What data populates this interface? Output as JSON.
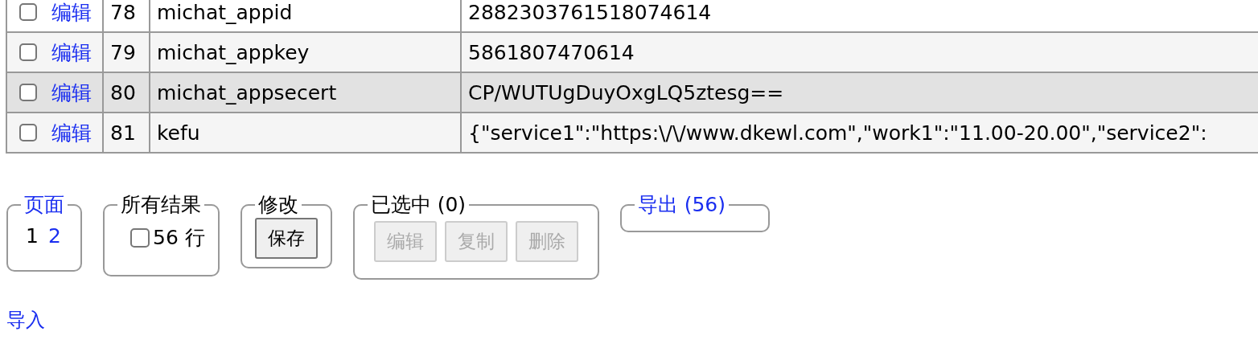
{
  "table": {
    "rows": [
      {
        "checked": false,
        "edit": "编辑",
        "id": "78",
        "name": "michat_appid",
        "value": "2882303761518074614",
        "hovered": false
      },
      {
        "checked": false,
        "edit": "编辑",
        "id": "79",
        "name": "michat_appkey",
        "value": "5861807470614",
        "hovered": false
      },
      {
        "checked": false,
        "edit": "编辑",
        "id": "80",
        "name": "michat_appsecert",
        "value": "CP/WUTUgDuyOxgLQ5ztesg==",
        "hovered": true
      },
      {
        "checked": false,
        "edit": "编辑",
        "id": "81",
        "name": "kefu",
        "value": "{\"service1\":\"https:\\/\\/www.dkewl.com\",\"work1\":\"11.00-20.00\",\"service2\":",
        "hovered": false
      }
    ]
  },
  "pages": {
    "legend": "页面",
    "items": [
      {
        "label": "1",
        "selected": true
      },
      {
        "label": "2",
        "selected": false
      }
    ]
  },
  "all_results": {
    "legend": "所有结果",
    "checked": false,
    "label": "56 行"
  },
  "modify": {
    "legend": "修改",
    "button": "保存"
  },
  "selection": {
    "legend": "已选中 (0)",
    "buttons": [
      {
        "label": "编辑",
        "disabled": true
      },
      {
        "label": "复制",
        "disabled": true
      },
      {
        "label": "删除",
        "disabled": true
      }
    ]
  },
  "export": {
    "legend": "导出 (56)"
  },
  "import": "导入"
}
